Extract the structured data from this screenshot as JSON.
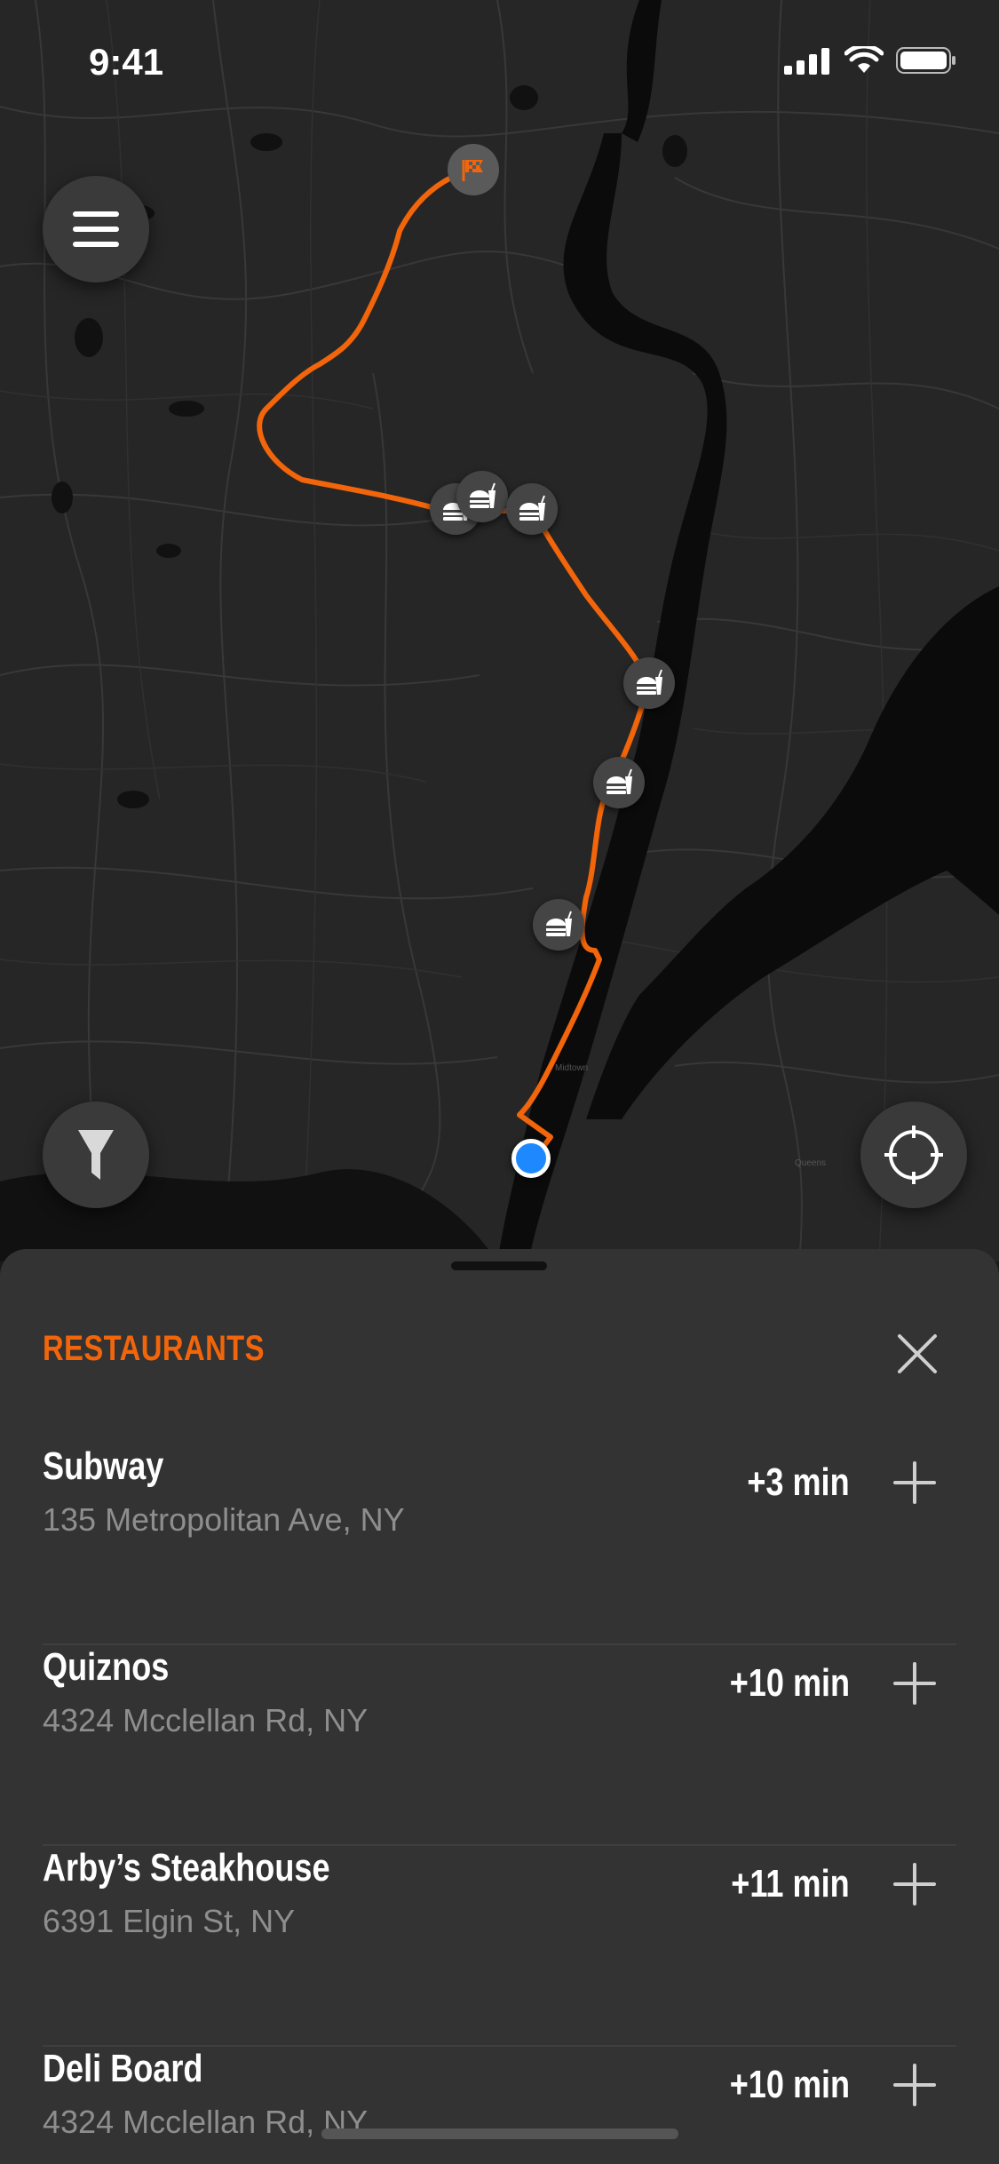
{
  "status_bar": {
    "time": "9:41"
  },
  "map": {
    "accent_color": "#f2650a",
    "user_location_color": "#1e88ff",
    "icons": {
      "destination": "checkered-flag-icon",
      "restaurant": "burger-drink-icon"
    }
  },
  "controls": {
    "menu": "hamburger-menu-icon",
    "filter": "filter-funnel-icon",
    "locate": "crosshair-locate-icon"
  },
  "sheet": {
    "title": "RESTAURANTS",
    "close_icon": "close-icon",
    "add_icon": "plus-icon",
    "items": [
      {
        "name": "Subway",
        "address": "135 Metropolitan Ave, NY",
        "eta": "+3 min"
      },
      {
        "name": "Quiznos",
        "address": "4324 Mcclellan Rd, NY",
        "eta": "+10 min"
      },
      {
        "name": "Arby’s Steakhouse",
        "address": "6391 Elgin St, NY",
        "eta": "+11 min"
      },
      {
        "name": "Deli Board",
        "address": "4324 Mcclellan Rd, NY",
        "eta": "+10 min"
      }
    ]
  }
}
